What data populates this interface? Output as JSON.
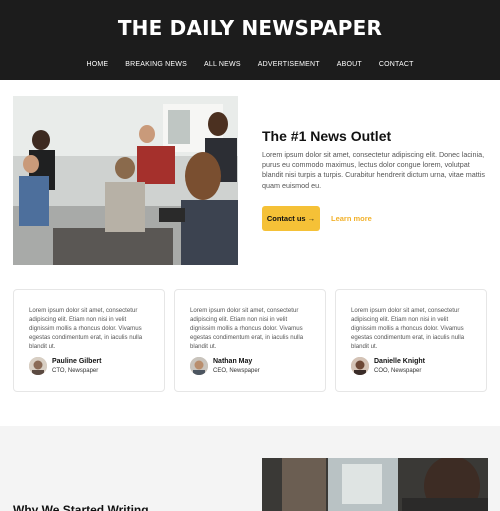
{
  "header": {
    "title": "THE DAILY NEWSPAPER",
    "nav": [
      "HOME",
      "BREAKING NEWS",
      "ALL NEWS",
      "ADVERTISEMENT",
      "ABOUT",
      "CONTACT"
    ]
  },
  "hero": {
    "title": "The #1 News Outlet",
    "text": "Lorem ipsum dolor sit amet, consectetur adipiscing elit. Donec lacinia, purus eu commodo maximus, lectus dolor congue lorem, volutpat blandit nisi turpis a turpis. Curabitur hendrerit dictum urna, vitae mattis quam euismod eu.",
    "contact_label": "Contact us →",
    "more_label": "Learn more"
  },
  "cards": [
    {
      "text": "Lorem ipsum dolor sit amet, consectetur adipiscing elit. Etiam non nisi in velit dignissim mollis a rhoncus dolor. Vivamus egestas condimentum erat, in iaculis nulla blandit ut.",
      "name": "Pauline Gilbert",
      "role": "CTO, Newspaper"
    },
    {
      "text": "Lorem ipsum dolor sit amet, consectetur adipiscing elit. Etiam non nisi in velit dignissim mollis a rhoncus dolor. Vivamus egestas condimentum erat, in iaculis nulla blandit ut.",
      "name": "Nathan May",
      "role": "CEO, Newspaper"
    },
    {
      "text": "Lorem ipsum dolor sit amet, consectetur adipiscing elit. Etiam non nisi in velit dignissim mollis a rhoncus dolor. Vivamus egestas condimentum erat, in iaculis nulla blandit ut.",
      "name": "Danielle Knight",
      "role": "COO, Newspaper"
    }
  ],
  "bottom": {
    "title": "Why We Started Writing"
  },
  "colors": {
    "header_bg": "#1c1c1c",
    "accent": "#f5c137",
    "accent_text": "#f2b12a"
  }
}
